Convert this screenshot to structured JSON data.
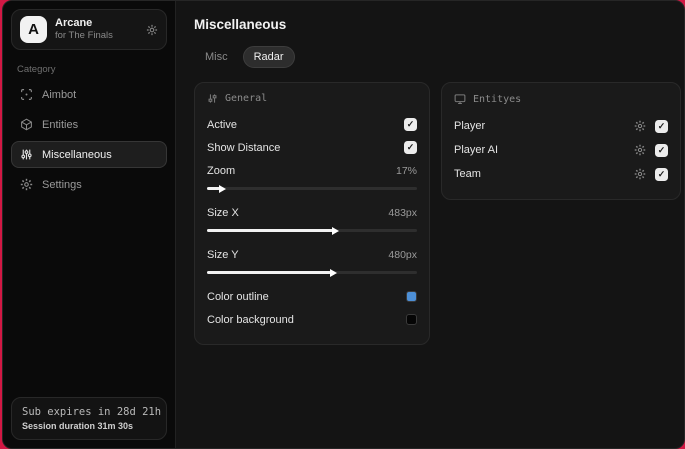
{
  "app": {
    "name": "Arcane",
    "subtitle": "for The Finals",
    "logo_letter": "A"
  },
  "sidebar": {
    "category_label": "Category",
    "items": [
      {
        "label": "Aimbot",
        "icon": "crosshair-icon",
        "active": false
      },
      {
        "label": "Entities",
        "icon": "cube-icon",
        "active": false
      },
      {
        "label": "Miscellaneous",
        "icon": "equalizer-icon",
        "active": true
      },
      {
        "label": "Settings",
        "icon": "gear-icon",
        "active": false
      }
    ],
    "footer": {
      "sub_expires": "Sub expires in 28d 21h",
      "session_duration": "Session duration 31m 30s"
    }
  },
  "main": {
    "title": "Miscellaneous",
    "tabs": [
      {
        "label": "Misc",
        "active": false
      },
      {
        "label": "Radar",
        "active": true
      }
    ]
  },
  "general_panel": {
    "title": "General",
    "active": {
      "label": "Active",
      "checked": true
    },
    "show_distance": {
      "label": "Show Distance",
      "checked": true
    },
    "zoom": {
      "label": "Zoom",
      "value": "17%",
      "slider_percent": 6
    },
    "size_x": {
      "label": "Size X",
      "value": "483px",
      "slider_percent": 60
    },
    "size_y": {
      "label": "Size Y",
      "value": "480px",
      "slider_percent": 59
    },
    "color_outline": {
      "label": "Color outline",
      "color": "#4d8fd6"
    },
    "color_background": {
      "label": "Color background",
      "color": "#050505"
    }
  },
  "entities_panel": {
    "title": "Entityes",
    "rows": [
      {
        "label": "Player",
        "checked": true
      },
      {
        "label": "Player AI",
        "checked": true
      },
      {
        "label": "Team",
        "checked": true
      }
    ]
  },
  "colors": {
    "desktop_background": "#d21844",
    "outline_swatch": "#4d8fd6",
    "background_swatch": "#050505"
  }
}
